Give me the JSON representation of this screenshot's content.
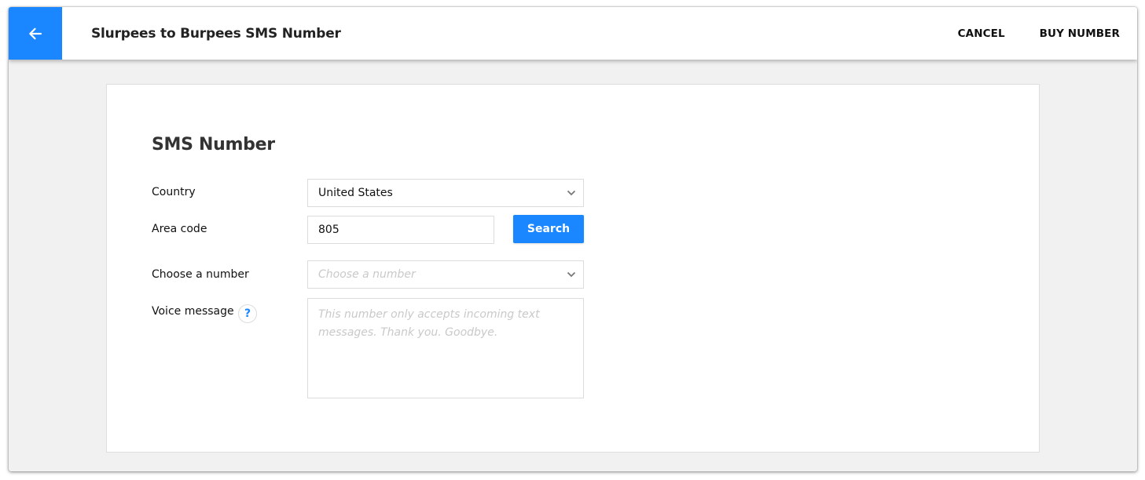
{
  "header": {
    "back_icon": "arrow-left-icon",
    "title": "Slurpees to Burpees SMS Number",
    "cancel_label": "CANCEL",
    "buy_label": "BUY NUMBER"
  },
  "colors": {
    "accent": "#1a86ff",
    "background": "#f1f1f1"
  },
  "form": {
    "section_title": "SMS Number",
    "country": {
      "label": "Country",
      "value": "United States",
      "icon": "chevron-down-icon"
    },
    "area_code": {
      "label": "Area code",
      "value": "805"
    },
    "search_label": "Search",
    "number": {
      "label": "Choose a number",
      "placeholder": "Choose a number",
      "icon": "chevron-down-icon"
    },
    "voice_message": {
      "label": "Voice message",
      "help_glyph": "?",
      "placeholder": "This number only accepts incoming text messages. Thank you. Goodbye."
    }
  }
}
